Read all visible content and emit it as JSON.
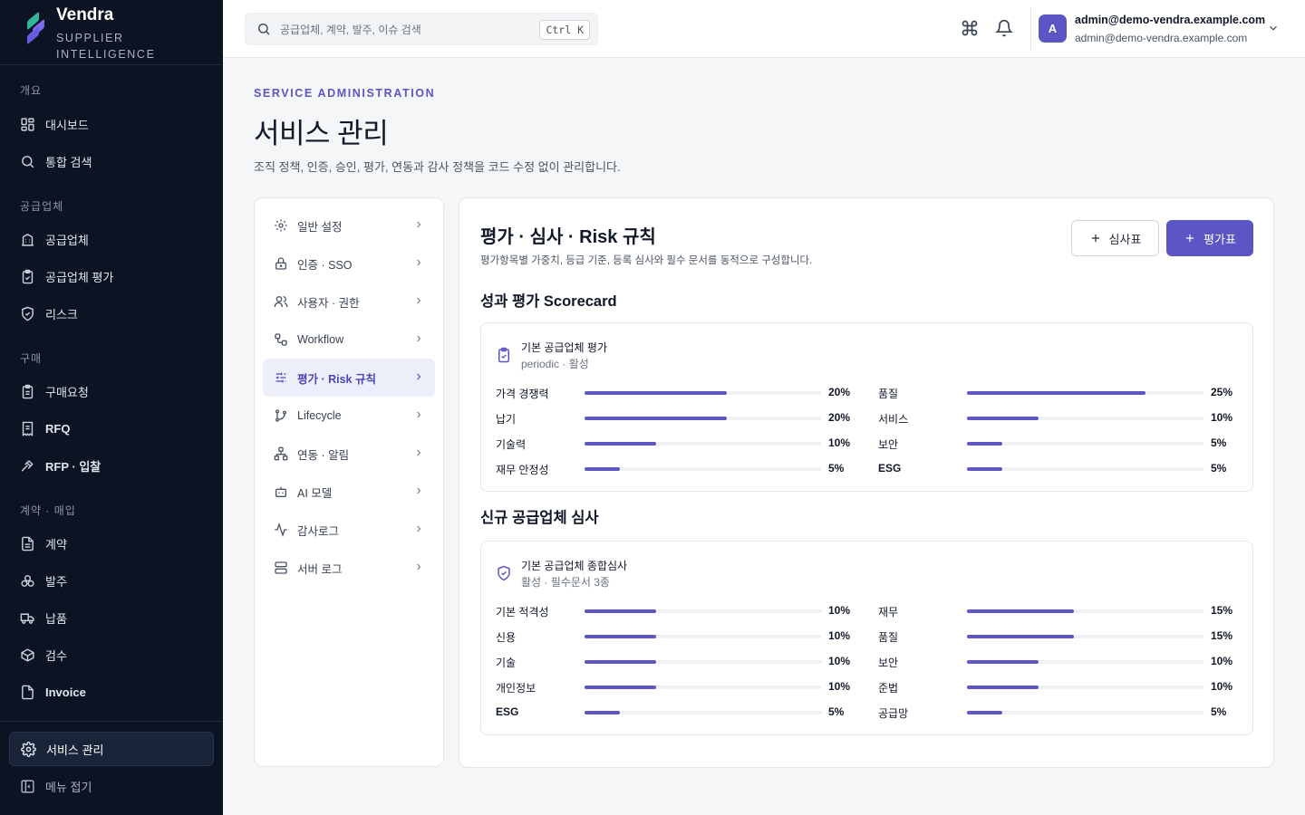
{
  "brand": {
    "name": "Vendra",
    "sub_line1": "SUPPLIER",
    "sub_line2": "INTELLIGENCE"
  },
  "sidebar": {
    "sections": {
      "overview": "개요",
      "supplier": "공급업체",
      "purchase": "구매",
      "contract": "계약 · 매입"
    },
    "items": [
      {
        "label": "대시보드",
        "icon": "dashboard-icon"
      },
      {
        "label": "통합 검색",
        "icon": "search-icon"
      },
      {
        "label": "공급업체",
        "icon": "building-icon"
      },
      {
        "label": "공급업체 평가",
        "icon": "clipboard-check-icon"
      },
      {
        "label": "리스크",
        "icon": "shield-check-icon"
      },
      {
        "label": "구매요청",
        "icon": "clipboard-list-icon"
      },
      {
        "label": "RFQ",
        "icon": "receipt-icon"
      },
      {
        "label": "RFP · 입찰",
        "icon": "gavel-icon"
      },
      {
        "label": "계약",
        "icon": "file-text-icon"
      },
      {
        "label": "발주",
        "icon": "boxes-icon"
      },
      {
        "label": "납품",
        "icon": "truck-icon"
      },
      {
        "label": "검수",
        "icon": "package-check-icon"
      },
      {
        "label": "Invoice",
        "icon": "file-icon"
      },
      {
        "label": "서비스 관리",
        "icon": "gear-icon"
      },
      {
        "label": "메뉴 접기",
        "icon": "collapse-icon"
      }
    ]
  },
  "topbar": {
    "search_placeholder": "공급업체, 계약, 발주, 이슈 검색",
    "shortcut": "Ctrl K",
    "user": {
      "initial": "A",
      "name": "admin@demo-vendra.example.com",
      "email": "admin@demo-vendra.example.com"
    }
  },
  "header": {
    "eyebrow": "SERVICE ADMINISTRATION",
    "title": "서비스 관리",
    "description": "조직 정책, 인증, 승인, 평가, 연동과 감사 정책을 코드 수정 없이 관리합니다."
  },
  "settings_menu": [
    {
      "label": "일반 설정",
      "icon": "gear-icon"
    },
    {
      "label": "인증 · SSO",
      "icon": "lock-icon"
    },
    {
      "label": "사용자 · 권한",
      "icon": "users-icon"
    },
    {
      "label": "Workflow",
      "icon": "workflow-icon"
    },
    {
      "label": "평가 · Risk 규칙",
      "icon": "sliders-icon"
    },
    {
      "label": "Lifecycle",
      "icon": "git-branch-icon"
    },
    {
      "label": "연동 · 알림",
      "icon": "network-icon"
    },
    {
      "label": "AI 모델",
      "icon": "bot-icon"
    },
    {
      "label": "감사로그",
      "icon": "activity-icon"
    },
    {
      "label": "서버 로그",
      "icon": "server-icon"
    }
  ],
  "panel": {
    "title_prefix": "평가 · 심사 · ",
    "title_bold": "Risk",
    "title_suffix": " 규칙",
    "description": "평가항목별 가중치, 등급 기준, 등록 심사와 필수 문서를 동적으로 구성합니다.",
    "btn_review": "심사표",
    "btn_scorecard": "평가표"
  },
  "scorecard_section": {
    "title_prefix": "성과 평가 ",
    "title_bold": "Scorecard",
    "card": {
      "name": "기본 공급업체 평가",
      "meta": "periodic · 활성",
      "criteria": [
        {
          "label": "가격 경쟁력",
          "value": "20%",
          "weight": 20
        },
        {
          "label": "납기",
          "value": "20%",
          "weight": 20
        },
        {
          "label": "기술력",
          "value": "10%",
          "weight": 10
        },
        {
          "label": "재무 안정성",
          "value": "5%",
          "weight": 5
        },
        {
          "label": "품질",
          "value": "25%",
          "weight": 25
        },
        {
          "label": "서비스",
          "value": "10%",
          "weight": 10
        },
        {
          "label": "보안",
          "value": "5%",
          "weight": 5
        },
        {
          "label": "ESG",
          "value": "5%",
          "weight": 5
        }
      ]
    }
  },
  "review_section": {
    "title": "신규 공급업체 심사",
    "card": {
      "name": "기본 공급업체 종합심사",
      "meta": "활성 · 필수문서 3종",
      "criteria": [
        {
          "label": "기본 적격성",
          "value": "10%",
          "weight": 10
        },
        {
          "label": "신용",
          "value": "10%",
          "weight": 10
        },
        {
          "label": "기술",
          "value": "10%",
          "weight": 10
        },
        {
          "label": "개인정보",
          "value": "10%",
          "weight": 10
        },
        {
          "label": "ESG",
          "value": "5%",
          "weight": 5
        },
        {
          "label": "재무",
          "value": "15%",
          "weight": 15
        },
        {
          "label": "품질",
          "value": "15%",
          "weight": 15
        },
        {
          "label": "보안",
          "value": "10%",
          "weight": 10
        },
        {
          "label": "준법",
          "value": "10%",
          "weight": 10
        },
        {
          "label": "공급망",
          "value": "5%",
          "weight": 5
        }
      ]
    }
  },
  "colors": {
    "accent": "#5b56c4",
    "sidebar_bg": "#0c1322",
    "page_bg": "#f5f6f8"
  }
}
